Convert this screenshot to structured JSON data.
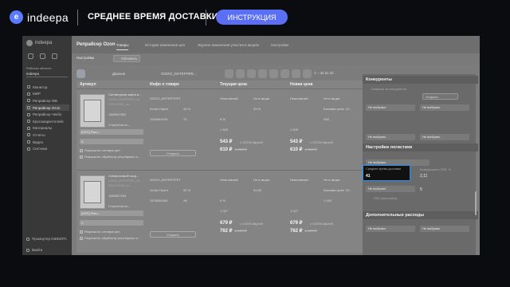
{
  "header": {
    "logo_text": "indeepa",
    "title": "СРЕДНЕЕ ВРЕМЯ ДОСТАВКИ",
    "button_label": "ИНСТРУКЦИЯ"
  },
  "sidebar": {
    "logo_text": "indeepa",
    "area_label": "Рабочая область",
    "area_value": "indeepa",
    "items": [
      {
        "label": "Монитор"
      },
      {
        "label": "МИР"
      },
      {
        "label": "Репрайсер WB"
      },
      {
        "label": "Репрайсер Ozon"
      },
      {
        "label": "Репрайсер Чекбо"
      },
      {
        "label": "Кроссмаркетплейс"
      },
      {
        "label": "Материалы"
      },
      {
        "label": "Отчеты"
      },
      {
        "label": "Видео"
      },
      {
        "label": "Система"
      }
    ],
    "bottom_item": "Промоутер INDEEPA",
    "exit_item": "Выйти"
  },
  "app": {
    "title": "Репрайсер Ozon",
    "tabs": [
      "Товары",
      "История изменения цен",
      "Журнал изменения участия в акциях",
      "Настройки"
    ],
    "settings_label": "Настройки",
    "refresh_label": "Обновить"
  },
  "toolbar": {
    "filter_chip": "Данные",
    "search_chip": "ОООО_ИНТЕРПРЕ…",
    "paging": "1 – 42   из 42"
  },
  "table": {
    "headers": [
      "Артикул",
      "Инфо о товаре",
      "Текущая цена",
      "Новая цена"
    ],
    "rows": [
      {
        "name": "Сигнатурная карта в...",
        "article": "ОООО_ИНТЕРПРЕ_шт...",
        "code": "2231470367_шт...",
        "sku": "1569537820",
        "rrc_label": "Стратегия по...",
        "sku_short": "[DRS] Рекл...",
        "extra": "А",
        "check1": "Разрешить оптовую цен",
        "check2": "Разрешить обработку регулярных а...",
        "seller": "ОООО_ИНТЕРПРЕТ",
        "brand": "Атлас Принт",
        "margin": "44 %",
        "id": "1944064376",
        "stock": "73",
        "cur_status": "Неактивный",
        "cur_flag": "Не в акции",
        "cur_disc": "43 %",
        "cur_a": "5 %",
        "cur_b": "1 525",
        "cur_c": "1 525",
        "cur_price_ozon": "543 ₽",
        "cur_price": "610 ₽",
        "cur_old": "1 454 ₽",
        "new_status": "Неактивный",
        "new_flag": "Не в акции",
        "new_disc": "Базовая цена: 19...",
        "new_a": "438",
        "new_b": "1 525",
        "new_price_ozon": "543 ₽",
        "new_price": "610 ₽",
        "new_old": "1 454 ₽",
        "ozon_card": "с OZON Картой",
        "open": "Открыть"
      },
      {
        "name": "Схема низкой скор...",
        "article": "ОООО_ИНТЕРПРЕ_шт...",
        "code": "2231470233_шт...",
        "sku": "1569507203",
        "rrc_label": "Стратегия по...",
        "sku_short": "[DRS] Рекл...",
        "extra": "С",
        "check1": "Разрешить оптовую цен",
        "check2": "Разрешить обработку регулярных а...",
        "seller": "ОООО_ИНТЕРПРЕТ",
        "brand": "Атлас Принт",
        "margin": "52 %",
        "id": "1576950303",
        "stock": "28",
        "cur_status": "Неактивный",
        "cur_flag": "Не в акции",
        "cur_disc": "51,85",
        "cur_a": "5 %",
        "cur_b": "1 027",
        "cur_c": "1 027",
        "cur_price_ozon": "679 ₽",
        "cur_price": "762 ₽",
        "cur_old": "1 467 ₽",
        "new_status": "Неактивный",
        "new_flag": "Не в акции",
        "new_disc": "Базовая цена: 19...",
        "new_a": "1 043",
        "new_b": "1 027",
        "new_price_ozon": "679 ₽",
        "new_price": "762 ₽",
        "new_old": "1 467 ₽",
        "ozon_card": "с OZON Картой",
        "open": "Открыть"
      }
    ]
  },
  "right_panel": {
    "sec1": "Конкуренты",
    "sec1_field": "Сведения за конкурентов",
    "sec1_btn": "Открыть",
    "sel_none": "Не выбрано",
    "sec2": "Настройки логистики",
    "logistics_field": "Не выбрано",
    "highlight_label": "Среднее время доставки",
    "highlight_value": "41",
    "ratio_label": "Коэффициент FBS, %",
    "ratio_value": "2,11",
    "sub_value": "5",
    "fbs_label": "FBS (настройка)",
    "sec3": "Дополнительные расходы",
    "extra1": "Не выбрано",
    "extra2": "Не выбрано"
  },
  "colors": {
    "accent": "#5b6ff5",
    "highlight_border": "#1e90ff"
  }
}
